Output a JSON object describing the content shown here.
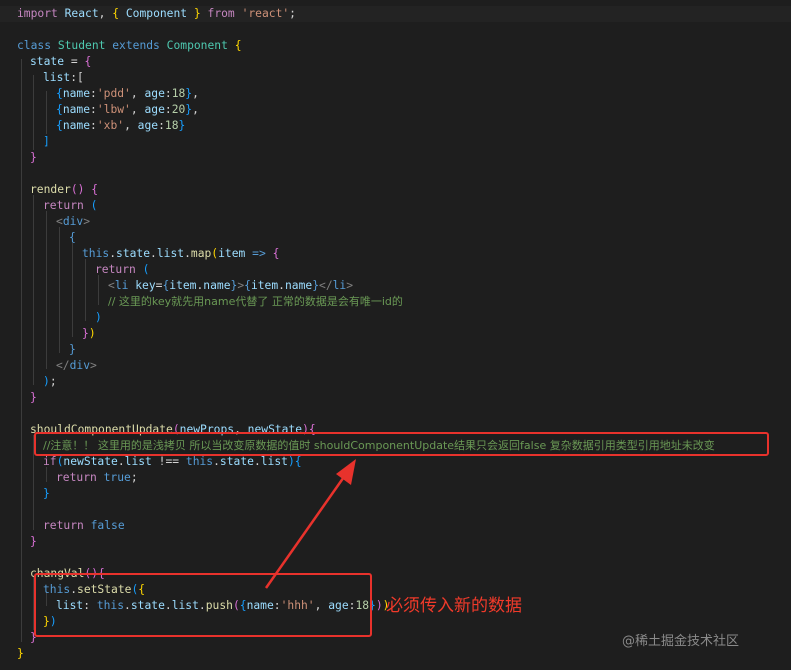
{
  "code": {
    "l1": [
      "import",
      "React",
      "Component",
      "from",
      "'react'"
    ],
    "l2": [
      "class",
      "Student",
      "extends",
      "Component"
    ],
    "l3": [
      "state",
      "="
    ],
    "l4": [
      "list",
      ":["
    ],
    "l5": [
      "name",
      "'pdd'",
      "age",
      "18"
    ],
    "l6": [
      "name",
      "'lbw'",
      "age",
      "20"
    ],
    "l7": [
      "name",
      "'xb'",
      "age",
      "18"
    ],
    "l10": [
      "render"
    ],
    "l11": [
      "return"
    ],
    "l12": [
      "div"
    ],
    "l14": [
      "this",
      "state",
      "list",
      "map",
      "item",
      "=>"
    ],
    "l15": [
      "return"
    ],
    "l16": [
      "li",
      "key",
      "item",
      "name",
      "item",
      "name",
      "li"
    ],
    "l17": "// 这里的key就先用name代替了 正常的数据是会有唯一id的",
    "l21": [
      "div"
    ],
    "l24": [
      "shouldComponentUpdate",
      "newProps",
      "newState"
    ],
    "l25": "//注意！！ 这里用的是浅拷贝 所以当改变原数据的值时 shouldComponentUpdate结果只会返回false 复杂数据引用类型引用地址未改变",
    "l26": [
      "if",
      "newState",
      "list",
      "this",
      "state",
      "list"
    ],
    "l27": [
      "return",
      "true"
    ],
    "l29": [
      "return",
      "false"
    ],
    "l31": [
      "changVal"
    ],
    "l32": [
      "this",
      "setState"
    ],
    "l33": [
      "list",
      "this",
      "state",
      "list",
      "push",
      "name",
      "'hhh'",
      "age",
      "18"
    ]
  },
  "annotation": "必须传入新的数据",
  "watermark": "@稀土掘金技术社区",
  "colors": {
    "highlight_box": "#e8322c",
    "annotation_text": "#f03a2a"
  }
}
